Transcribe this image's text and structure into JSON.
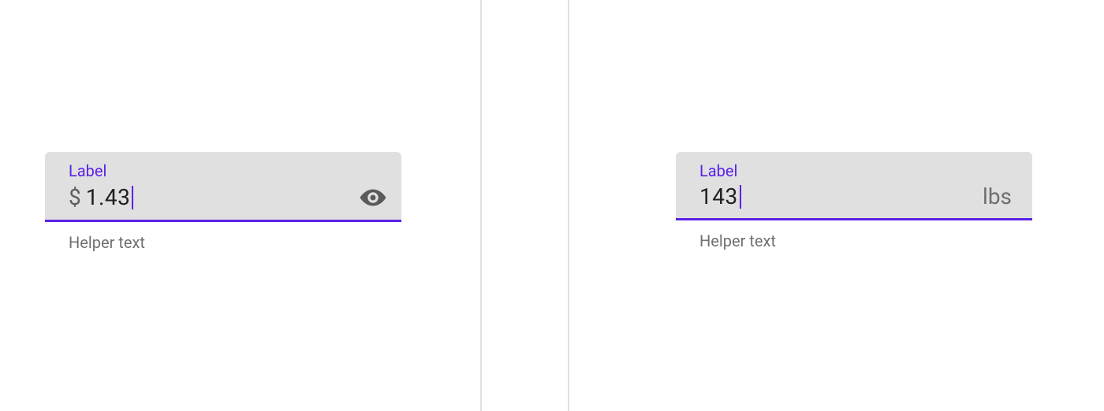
{
  "colors": {
    "accent": "#5a22e6",
    "fieldBg": "#e0e0e0",
    "helper": "#707070"
  },
  "leftField": {
    "label": "Label",
    "prefix": "$",
    "value": "1.43",
    "helper": "Helper text",
    "trailingIcon": "visibility-icon"
  },
  "rightField": {
    "label": "Label",
    "value": "143",
    "suffix": "lbs",
    "helper": "Helper text"
  }
}
